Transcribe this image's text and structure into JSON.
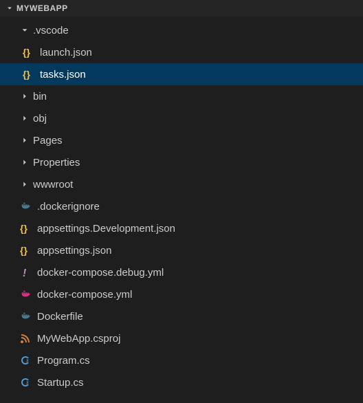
{
  "section_title": "MYWEBAPP",
  "tree": {
    "vscode_folder": ".vscode",
    "vscode_children": {
      "launch": "launch.json",
      "tasks": "tasks.json"
    },
    "bin_folder": "bin",
    "obj_folder": "obj",
    "pages_folder": "Pages",
    "properties_folder": "Properties",
    "wwwroot_folder": "wwwroot",
    "dockerignore": ".dockerignore",
    "appsettings_dev": "appsettings.Development.json",
    "appsettings": "appsettings.json",
    "docker_compose_debug": "docker-compose.debug.yml",
    "docker_compose": "docker-compose.yml",
    "dockerfile": "Dockerfile",
    "csproj": "MyWebApp.csproj",
    "program": "Program.cs",
    "startup": "Startup.cs"
  },
  "selected_item": "tasks.json"
}
